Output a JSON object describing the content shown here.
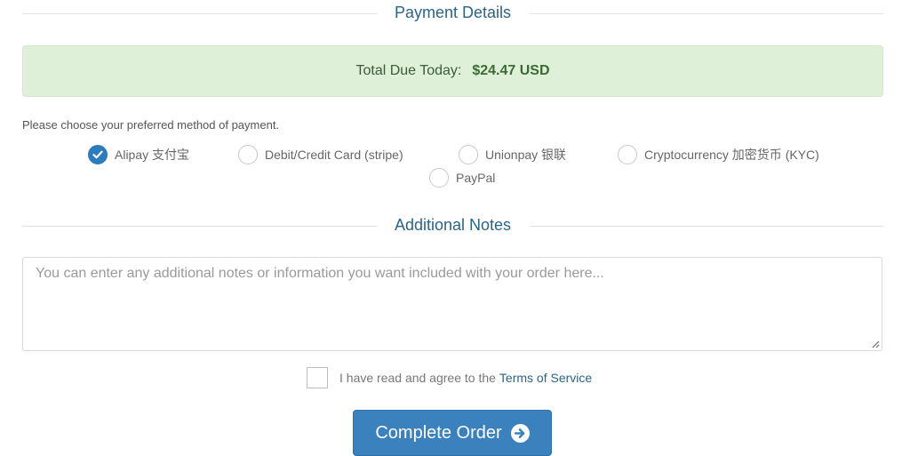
{
  "payment_section": {
    "title": "Payment Details"
  },
  "total": {
    "label": "Total Due Today:",
    "amount": "$24.47 USD"
  },
  "payment_methods": {
    "prompt": "Please choose your preferred method of payment.",
    "selected": "alipay",
    "options": [
      {
        "id": "alipay",
        "label": "Alipay 支付宝",
        "checked": true
      },
      {
        "id": "stripe",
        "label": "Debit/Credit Card (stripe)",
        "checked": false
      },
      {
        "id": "unionpay",
        "label": "Unionpay 银联",
        "checked": false
      },
      {
        "id": "crypto",
        "label": "Cryptocurrency 加密货币 (KYC)",
        "checked": false
      },
      {
        "id": "paypal",
        "label": "PayPal",
        "checked": false
      }
    ]
  },
  "notes_section": {
    "title": "Additional Notes",
    "value": "",
    "placeholder": "You can enter any additional notes or information you want included with your order here..."
  },
  "tos": {
    "checked": false,
    "text": "I have read and agree to the",
    "link_label": "Terms of Service"
  },
  "submit": {
    "label": "Complete Order"
  },
  "colors": {
    "accent": "#3a81bd",
    "heading": "#2b6486",
    "success_bg": "#dff0d8",
    "success_text": "#3b6b33"
  },
  "icons": {
    "checked_radio": "check-icon",
    "submit_arrow": "arrow-circle-right-icon",
    "textarea_resize": "resize-grip-icon"
  }
}
